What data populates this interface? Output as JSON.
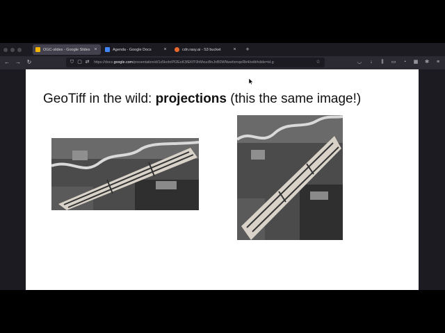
{
  "browser": {
    "tabs": [
      {
        "label": "OGC-slides - Google Slides",
        "icon": "google-slides-icon",
        "color": "#f4b400",
        "active": true
      },
      {
        "label": "Agenda - Google Docs",
        "icon": "google-docs-icon",
        "color": "#4285f4",
        "active": false
      },
      {
        "label": "cdn.rasy.ai - S3 bucket",
        "icon": "s3-bucket-icon",
        "color": "#e8692b",
        "active": false
      }
    ],
    "new_tab": "+",
    "url_prefix": "https://docs.",
    "url_domain": "google.com",
    "url_rest": "/presentation/d/1s5kohrlPl2EoK3fEKfT0hMvucBnJnB0WNwefsmqeRb4/edit#slide=id.g"
  },
  "slide": {
    "title_plain": "GeoTiff in the wild: ",
    "title_bold": "projections",
    "title_rest": " (this the same image!)",
    "images": [
      {
        "name": "airport-image-projection-a",
        "icon": "aerial-photo"
      },
      {
        "name": "airport-image-projection-b",
        "icon": "aerial-photo"
      }
    ]
  }
}
